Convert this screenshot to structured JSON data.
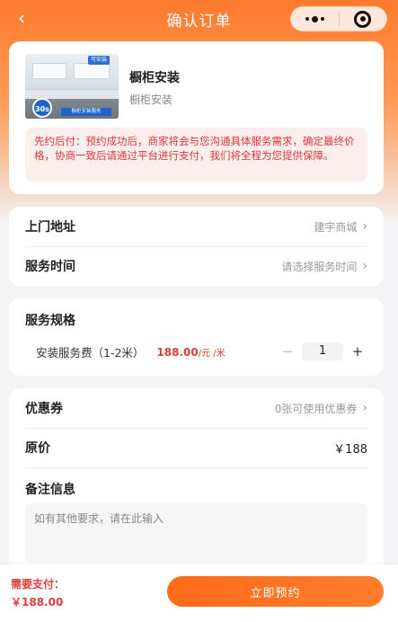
{
  "nav": {
    "title": "确认订单",
    "back_icon": "chevron-left-icon"
  },
  "product": {
    "name": "橱柜安装",
    "subtitle": "橱柜安装",
    "thumb_tag": "可安装",
    "thumb_badge": "30s",
    "thumb_ribbon": "橱柜安装服务",
    "notice": "先约后付：预约成功后，商家将会与您沟通具体服务需求，确定最终价格，协商一致后请通过平台进行支付，我们将全程为您提供保障。"
  },
  "address": {
    "label": "上门地址",
    "value": "建宇商城"
  },
  "service_time": {
    "label": "服务时间",
    "value": "请选择服务时间"
  },
  "spec": {
    "title": "服务规格",
    "item_name": "安装服务费（1-2米）",
    "price": "188.00",
    "unit": "/元 /米",
    "quantity": "1",
    "minus": "−",
    "plus": "+"
  },
  "coupon": {
    "label": "优惠券",
    "value": "0张可使用优惠券"
  },
  "original_price": {
    "label": "原价",
    "value": "￥188"
  },
  "remark": {
    "label": "备注信息",
    "placeholder": "如有其他要求，请在此输入"
  },
  "footer": {
    "pay_label": "需要支付：",
    "pay_amount": "￥188.00",
    "submit_label": "立即预约"
  },
  "colors": {
    "accent": "#ff6b1a",
    "price_red": "#e23b3b",
    "notice_bg": "#fdeeee"
  }
}
